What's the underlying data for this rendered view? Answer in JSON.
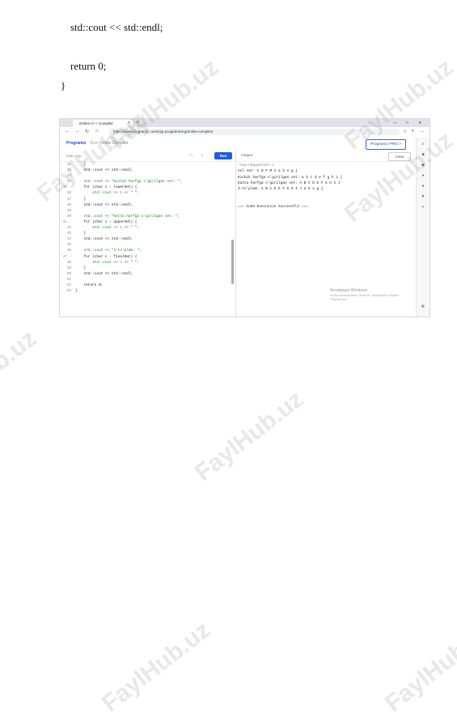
{
  "document": {
    "lines": [
      "std::cout << std::endl;",
      "return 0;",
      "}"
    ]
  },
  "watermark": "FaylHub.uz",
  "browser": {
    "tab_title": "Online C++ Compiler",
    "tab_close": "×",
    "new_tab": "+",
    "window_controls": [
      "—",
      "□",
      "✕"
    ],
    "address": "https://www.programiz.com/cpp-programming/online-compiler/",
    "nav_icons": [
      "←",
      "→",
      "↻",
      "⌂"
    ],
    "right_icons": [
      "☆",
      "◑",
      "…"
    ]
  },
  "app": {
    "logo": "Programiz",
    "title": "C++ Online Compiler",
    "pro_button": "Programiz PRO >"
  },
  "editor": {
    "file_name": "main.cpp",
    "icons": [
      "□",
      "☼"
    ],
    "run_label": "Run",
    "lines": [
      {
        "n": "31",
        "t": "    }"
      },
      {
        "n": "32",
        "t": "    std::cout << std::endl;"
      },
      {
        "n": "33",
        "t": ""
      },
      {
        "n": "34",
        "t": "    std::cout << \"Kichik harfga o'girilgan set: \";"
      },
      {
        "n": "35 -",
        "t": "    for (char c : lowerSet) {"
      },
      {
        "n": "36",
        "t": "        std::cout << c << \" \";"
      },
      {
        "n": "37",
        "t": "    }"
      },
      {
        "n": "38",
        "t": "    std::cout << std::endl;"
      },
      {
        "n": "39",
        "t": ""
      },
      {
        "n": "40",
        "t": "    std::cout << \"Katta harfga o'girilgan set: \";"
      },
      {
        "n": "41 -",
        "t": "    for (char c : upperSet) {"
      },
      {
        "n": "42",
        "t": "        std::cout << c << \" \";"
      },
      {
        "n": "43",
        "t": "    }"
      },
      {
        "n": "44",
        "t": "    std::cout << std::endl;"
      },
      {
        "n": "45",
        "t": ""
      },
      {
        "n": "46",
        "t": "    std::cout << \"3-to'plam: \";"
      },
      {
        "n": "47 -",
        "t": "    for (char c : finalSet) {"
      },
      {
        "n": "48",
        "t": "        std::cout << c << \" \";"
      },
      {
        "n": "49",
        "t": "    }"
      },
      {
        "n": "50",
        "t": "    std::cout << std::endl;"
      },
      {
        "n": "51",
        "t": ""
      },
      {
        "n": "52",
        "t": "    return 0;"
      },
      {
        "n": "53",
        "t": "}"
      }
    ]
  },
  "output": {
    "label": "Output",
    "clear_label": "Clear",
    "lines": [
      "/tmp/nKQqVG2e5T.o",
      "Asl set: C D F M I a b e g j",
      "Kichik harfga o'girilgan set: a b c d e f g h i j",
      "Katta harfga o'girilgan set: A B C D E F G H I J",
      "3-to'plam: A B C D E F G H I J a b e g j",
      "",
      "",
      "=== Code Execution Successful ==="
    ],
    "activation_title": "Активация Windows",
    "activation_text": "Чтобы активировать Windows, перейдите в раздел \"Параметры\"."
  },
  "sidebar_icons": [
    "⌕",
    "■",
    "◆",
    "●",
    "●",
    "▼",
    "+",
    "⚙"
  ],
  "colors": {
    "accent": "#1d5ee6",
    "brand": "#1e4fbf"
  }
}
